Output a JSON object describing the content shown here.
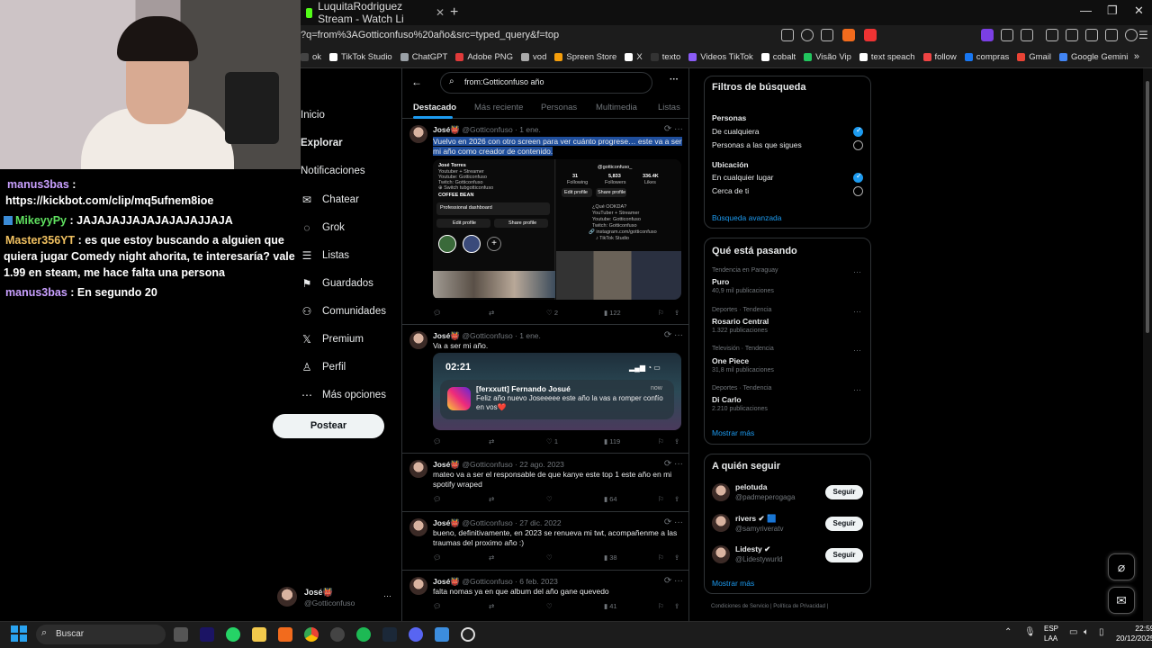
{
  "browser": {
    "tab_title": "LuquitaRodriguez Stream - Watch Li",
    "new_tab": "+",
    "url": "?q=from%3AGotticonfuso%20año&src=typed_query&f=top",
    "window_controls": [
      "—",
      "❐",
      "✕"
    ],
    "bookmarks": [
      "ok",
      "TikTok Studio",
      "ChatGPT",
      "Adobe PNG",
      "vod",
      "Spreen Store",
      "X",
      "texto",
      "Videos TikTok",
      "cobalt",
      "Visão Vip",
      "text speach",
      "follow",
      "compras",
      "Gmail",
      "Google Gemini"
    ],
    "bookmark_colors": [
      "#444444",
      "#ffffff",
      "#9aa0a6",
      "#e03a3a",
      "#aaaaaa",
      "#f59e0b",
      "#ffffff",
      "#333333",
      "#8b5cf6",
      "#ffffff",
      "#22c55e",
      "#ffffff",
      "#ef4444",
      "#1877f2",
      "#ea4335",
      "#4285f4"
    ]
  },
  "chat": {
    "messages": [
      {
        "user": "manus3bas",
        "color": "#c9a0ff",
        "text": "https://kickbot.com/clip/mq5ufnem8ioe",
        "badge": false
      },
      {
        "user": "MikeyyPy",
        "color": "#5fe05f",
        "text": "JAJAJAJJAJAJAJAJAJJAJA",
        "badge": true
      },
      {
        "user": "Master356YT",
        "color": "#f0c060",
        "text": "es que estoy buscando a alguien que quiera jugar Comedy night ahorita, te interesaría? vale 1.99 en steam, me hace falta una persona",
        "badge": false
      },
      {
        "user": "manus3bas",
        "color": "#c9a0ff",
        "text": "En segundo 20",
        "badge": false
      }
    ]
  },
  "nav": {
    "items": [
      {
        "label": "Inicio",
        "icon": "home-icon",
        "glyph": ""
      },
      {
        "label": "Explorar",
        "icon": "search-icon",
        "glyph": ""
      },
      {
        "label": "Notificaciones",
        "icon": "bell-icon",
        "glyph": ""
      },
      {
        "label": "Chatear",
        "icon": "mail-icon",
        "glyph": "✉"
      },
      {
        "label": "Grok",
        "icon": "grok-icon",
        "glyph": "◌"
      },
      {
        "label": "Listas",
        "icon": "list-icon",
        "glyph": "☰"
      },
      {
        "label": "Guardados",
        "icon": "bookmark-icon",
        "glyph": "⚑"
      },
      {
        "label": "Comunidades",
        "icon": "people-icon",
        "glyph": "⚇"
      },
      {
        "label": "Premium",
        "icon": "x-logo-icon",
        "glyph": "𝕏"
      },
      {
        "label": "Perfil",
        "icon": "user-icon",
        "glyph": "♙"
      },
      {
        "label": "Más opciones",
        "icon": "more-icon",
        "glyph": "⋯"
      }
    ],
    "post_button": "Postear",
    "account_name": "José👹",
    "account_handle": "@Gotticonfuso",
    "account_more": "···"
  },
  "search": {
    "back": "←",
    "query": "from:Gotticonfuso año",
    "more": "···",
    "tabs": [
      "Destacado",
      "Más reciente",
      "Personas",
      "Multimedia",
      "Listas"
    ]
  },
  "tweets": [
    {
      "name": "José👹",
      "handle": "@Gotticonfuso",
      "date": "1 ene.",
      "text_hl": "Vuelvo en 2026 con otro screen para ver cuánto progrese… este va a ser mi año como creador de contenido.",
      "likes": "2",
      "views": "122",
      "media": {
        "left_name": "José Torres",
        "left_lines": [
          "Youtuber + Streamer",
          "Youtube: Gotticonfuso",
          "Twitch: Gotticonfuso",
          "⊕ Switch tubgotticonfuso"
        ],
        "left_coffee": "COFFEE BEAN",
        "left_dashboard": "Professional dashboard",
        "left_edit": "Edit profile",
        "left_share": "Share profile",
        "right_handle": "@gotticonfuso_",
        "right_stats": [
          "31",
          "5,833",
          "336.4K"
        ],
        "right_stat_labels": [
          "Following",
          "Followers",
          "Likes"
        ],
        "right_edit": "Edit profile",
        "right_share": "Share profile",
        "right_bio": [
          "¿Qué OOKDA?",
          "YouTuber + Streamer",
          "Youtube: Gotticonfuso",
          "Twitch: Gotticonfuso",
          "🔗 instagram.com/gotticonfuso",
          "♪ TikTok Studio"
        ]
      }
    },
    {
      "name": "José👹",
      "handle": "@Gotticonfuso",
      "date": "1 ene.",
      "text": "Va a ser mi año.",
      "likes": "1",
      "views": "119",
      "media": {
        "time": "02:21",
        "notif_title": "[ferxxutt] Fernando Josué",
        "notif_when": "now",
        "notif_body": "Feliz año nuevo Joseeeee este año la vas a romper confío en vos❤️"
      }
    },
    {
      "name": "José👹",
      "handle": "@Gotticonfuso",
      "date": "22 ago. 2023",
      "text": "mateo va a ser el responsable de que kanye este top 1 este año en mi spotify wraped",
      "likes": "",
      "views": "64"
    },
    {
      "name": "José👹",
      "handle": "@Gotticonfuso",
      "date": "27 dic. 2022",
      "text": "bueno, definitivamente, en 2023 se renueva mi twt, acompañenme a las traumas del proximo año :)",
      "likes": "",
      "views": "38"
    },
    {
      "name": "José👹",
      "handle": "@Gotticonfuso",
      "date": "6 feb. 2023",
      "text": "falta nomas ya en que album del año gane quevedo",
      "likes": "",
      "views": "41"
    }
  ],
  "filters": {
    "title": "Filtros de búsqueda",
    "people_title": "Personas",
    "people_options": [
      "De cualquiera",
      "Personas a las que sigues"
    ],
    "location_title": "Ubicación",
    "location_options": [
      "En cualquier lugar",
      "Cerca de ti"
    ],
    "advanced": "Búsqueda avanzada"
  },
  "trends": {
    "title": "Qué está pasando",
    "items": [
      {
        "context": "Tendencia en Paraguay",
        "name": "Puro",
        "count": "40,9 mil publicaciones"
      },
      {
        "context": "Deportes · Tendencia",
        "name": "Rosario Central",
        "count": "1.322 publicaciones"
      },
      {
        "context": "Televisión · Tendencia",
        "name": "One Piece",
        "count": "31,8 mil publicaciones"
      },
      {
        "context": "Deportes · Tendencia",
        "name": "Di Carlo",
        "count": "2.210 publicaciones"
      }
    ],
    "show_more": "Mostrar más"
  },
  "follow": {
    "title": "A quién seguir",
    "users": [
      {
        "name": "pelotuda",
        "handle": "@padmeperogaga",
        "button": "Seguir"
      },
      {
        "name": "rivers ✔ 🟦",
        "handle": "@samyriveratv",
        "button": "Seguir"
      },
      {
        "name": "Lidesty ✔",
        "handle": "@Lidestywurld",
        "button": "Seguir"
      }
    ],
    "show_more": "Mostrar más",
    "footer": "Condiciones de Servicio  |  Política de Privacidad  |"
  },
  "taskbar": {
    "search": "Buscar",
    "lang1": "ESP",
    "lang2": "LAA",
    "time": "22:59",
    "date": "20/12/2025"
  },
  "colors": {
    "accent": "#1d9bf0",
    "bg": "#000000",
    "border": "#2f3336",
    "muted": "#71767b",
    "kick": "#53fc18"
  }
}
